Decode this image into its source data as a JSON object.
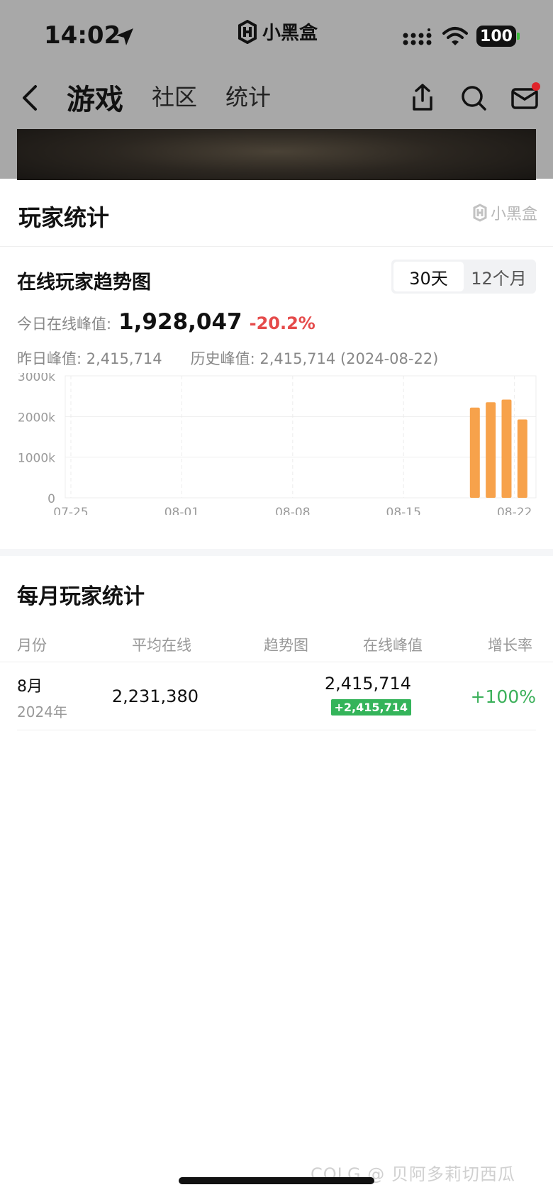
{
  "status_bar": {
    "time": "14:02",
    "app_name": "小黑盒",
    "battery": "100"
  },
  "nav": {
    "tabs": [
      "游戏",
      "社区",
      "统计"
    ],
    "active_tab": "游戏"
  },
  "sheet": {
    "title": "玩家统计",
    "watermark": "小黑盒",
    "trend": {
      "title": "在线玩家趋势图",
      "range_options": [
        "30天",
        "12个月"
      ],
      "selected_range": "30天",
      "today_label": "今日在线峰值:",
      "today_value": "1,928,047",
      "today_change": "-20.2%",
      "yesterday_text": "昨日峰值:  2,415,714",
      "history_text": "历史峰值:  2,415,714 (2024-08-22)"
    },
    "monthly": {
      "title": "每月玩家统计",
      "columns": [
        "月份",
        "平均在线",
        "趋势图",
        "在线峰值",
        "增长率"
      ],
      "rows": [
        {
          "month": "8月",
          "year": "2024年",
          "avg_online": "2,231,380",
          "peak": "2,415,714",
          "peak_change": "+2,415,714",
          "growth": "+100%"
        }
      ]
    }
  },
  "corner_watermark": "COLG @ 贝阿多莉切西瓜",
  "colors": {
    "bar": "#f7a24b",
    "negative": "#e54b4b",
    "positive": "#3bb05a",
    "badge": "#34b45a"
  },
  "chart_data": {
    "type": "bar",
    "x_ticks": [
      "07-25",
      "08-01",
      "08-08",
      "08-15",
      "08-22"
    ],
    "y_ticks": [
      "0",
      "1000k",
      "2000k",
      "3000k"
    ],
    "ylim": [
      0,
      3000000
    ],
    "x_dates": [
      "2024-08-19",
      "2024-08-20",
      "2024-08-21",
      "2024-08-22",
      "2024-08-23"
    ],
    "values": [
      2220000,
      2350000,
      2415714,
      1928047,
      null
    ],
    "grid": true
  }
}
